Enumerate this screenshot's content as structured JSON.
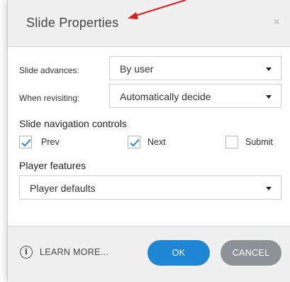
{
  "dialog": {
    "title": "Slide Properties",
    "close_glyph": "×"
  },
  "slide_advances": {
    "label": "Slide advances:",
    "value": "By user"
  },
  "when_revisiting": {
    "label": "When revisiting:",
    "value": "Automatically decide"
  },
  "navigation": {
    "heading": "Slide navigation controls",
    "controls": [
      {
        "label": "Prev",
        "checked": true
      },
      {
        "label": "Next",
        "checked": true
      },
      {
        "label": "Submit",
        "checked": false
      }
    ]
  },
  "player": {
    "heading": "Player features",
    "value": "Player defaults"
  },
  "footer": {
    "learn_more": "LEARN MORE...",
    "info_glyph": "i",
    "ok_label": "OK",
    "cancel_label": "CANCEL"
  },
  "colors": {
    "accent": "#1f86d6",
    "cancel": "#8c9297",
    "check": "#1f86d6",
    "annotation_arrow": "#e01a1a"
  }
}
